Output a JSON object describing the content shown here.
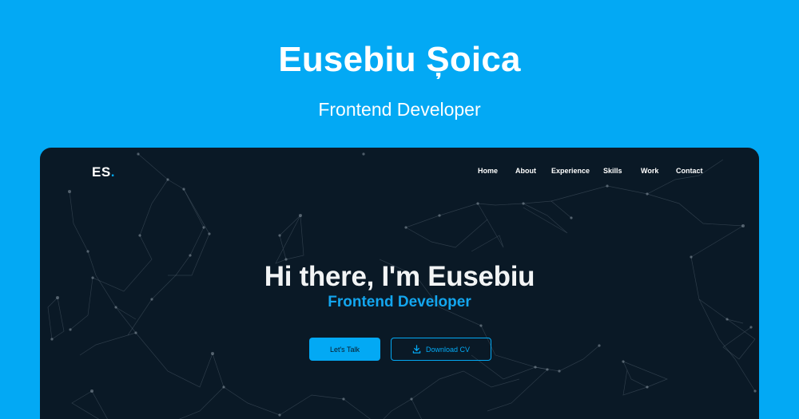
{
  "header": {
    "name": "Eusebiu Șoica",
    "role": "Frontend Developer"
  },
  "site": {
    "logo_text": "ES",
    "logo_dot": ".",
    "accent_color": "#03a9f4",
    "background_color": "#0a1926",
    "nav": [
      "Home",
      "About",
      "Experience",
      "Skills",
      "Work",
      "Contact"
    ],
    "hero": {
      "title": "Hi there, I'm Eusebiu",
      "subtitle": "Frontend Developer",
      "primary_button": "Let's Talk",
      "secondary_button": "Download CV",
      "secondary_button_icon": "download-icon"
    }
  }
}
